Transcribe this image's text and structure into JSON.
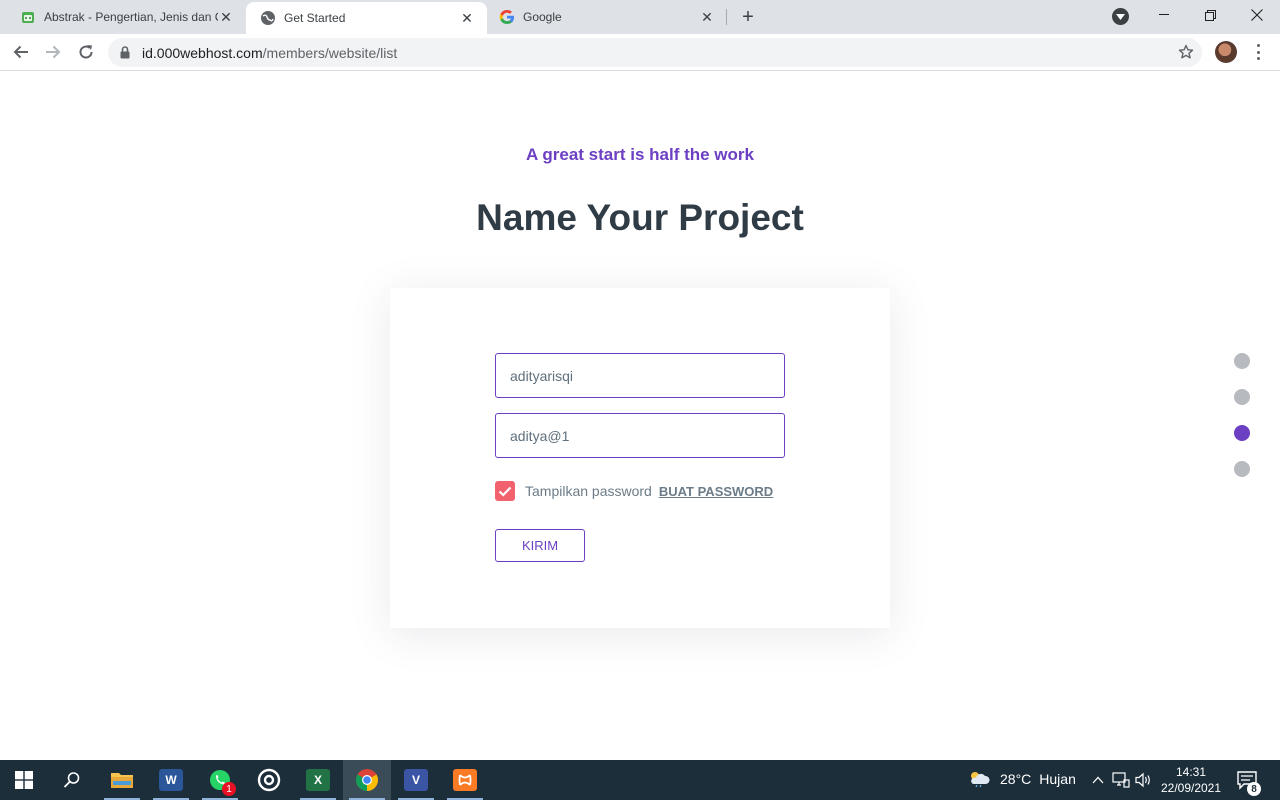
{
  "browser": {
    "tabs": [
      {
        "title": "Abstrak - Pengertian, Jenis dan C",
        "icon": "notebook-favicon-icon",
        "active": false
      },
      {
        "title": "Get Started",
        "icon": "globe-icon",
        "active": true
      },
      {
        "title": "Google",
        "icon": "google-icon",
        "active": false
      }
    ],
    "address": {
      "host": "id.000webhost.com",
      "path": "/members/website/list"
    }
  },
  "page": {
    "subtitle": "A great start is half the work",
    "heading": "Name Your Project",
    "form": {
      "project_name_value": "adityarisqi",
      "password_value": "aditya@1",
      "show_password_label": "Tampilkan password",
      "show_password_checked": true,
      "generate_password_link": "BUAT PASSWORD",
      "submit_label": "KIRIM"
    },
    "steps": {
      "total": 4,
      "current": 3
    }
  },
  "taskbar": {
    "apps": [
      "file-explorer-icon",
      "word-icon",
      "whatsapp-icon",
      "obs-icon",
      "excel-icon",
      "chrome-icon",
      "visio-icon",
      "xampp-icon"
    ],
    "whatsapp_badge": "1",
    "weather": {
      "temp": "28°C",
      "condition": "Hujan"
    },
    "clock": {
      "time": "14:31",
      "date": "22/09/2021"
    },
    "notification_count": "8"
  },
  "colors": {
    "accent": "#6c3fc3",
    "heading": "#2f3b45",
    "checkbox": "#f1626e",
    "taskbar": "#1c2e3a"
  }
}
